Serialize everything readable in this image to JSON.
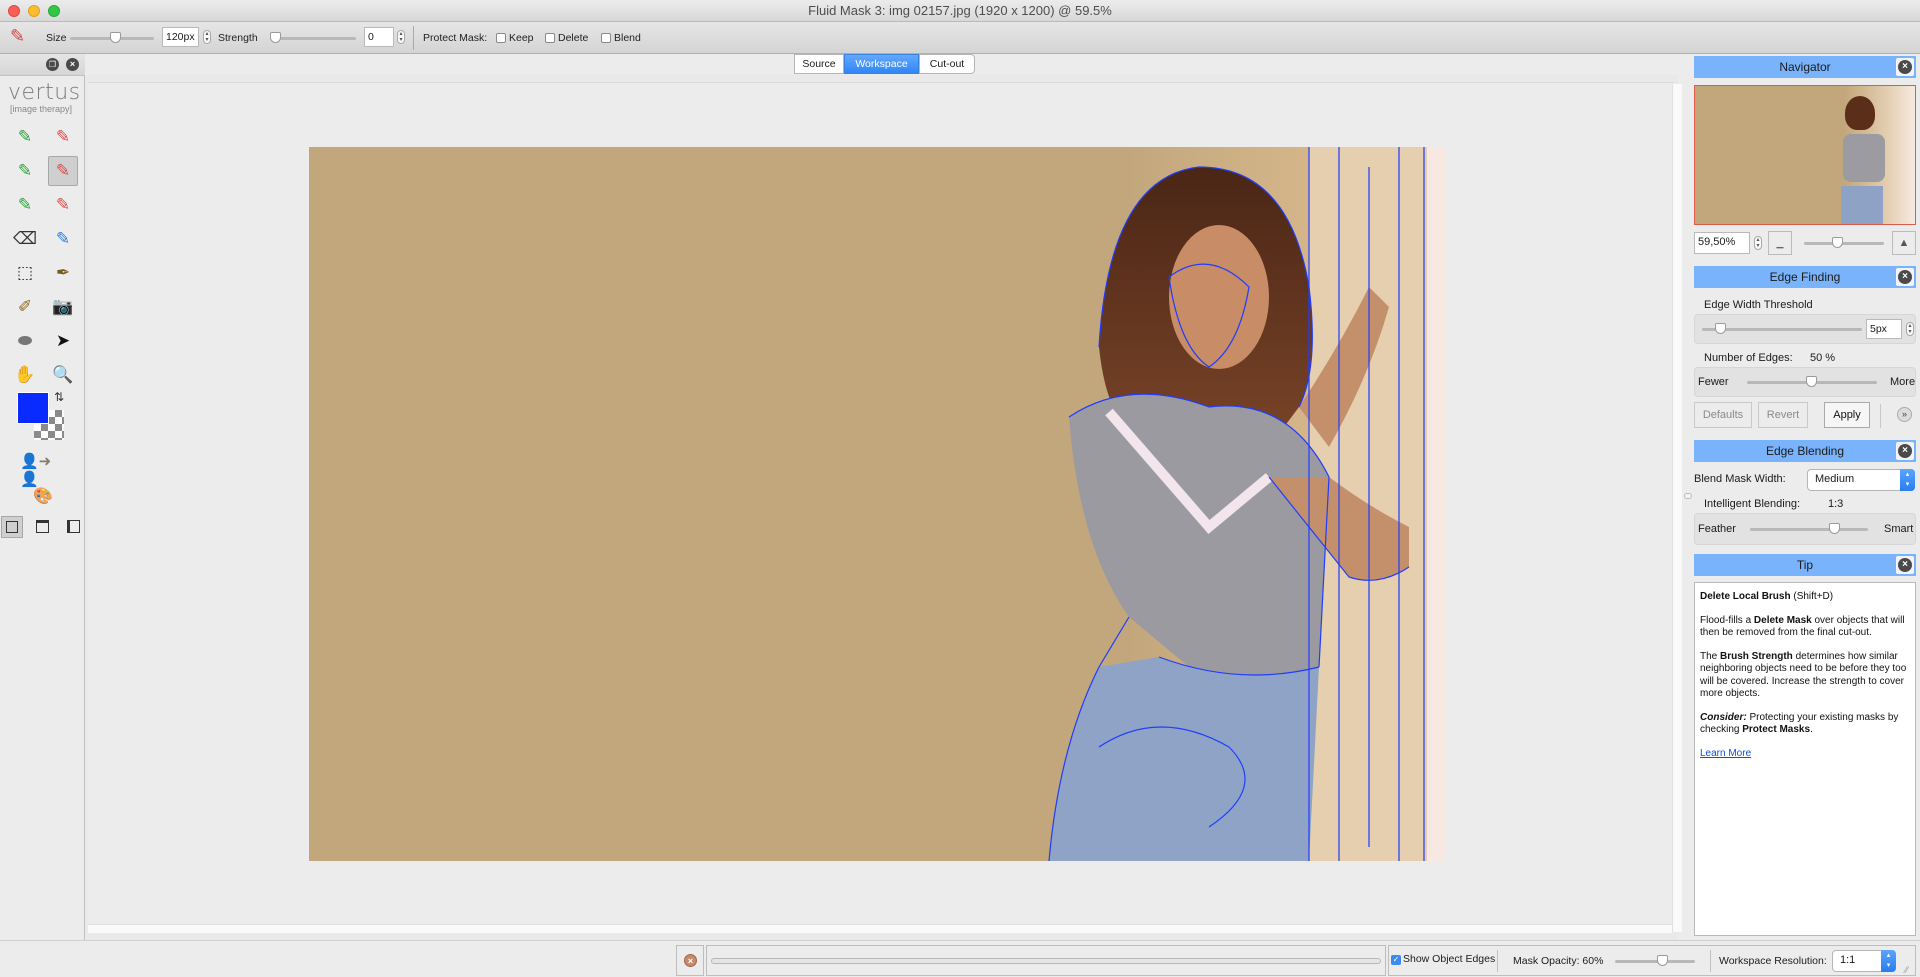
{
  "window": {
    "title": "Fluid Mask 3: img 02157.jpg (1920 x 1200) @ 59.5%",
    "traffic_lights": {
      "close": "#fc5f57",
      "minimize": "#fdbc2e",
      "zoom": "#33c748"
    }
  },
  "toolbar": {
    "brush_icon": "brush-icon",
    "size_label": "Size",
    "size_value": "120px",
    "size_slider_fraction": 0.55,
    "strength_label": "Strength",
    "strength_value": "0",
    "strength_slider_fraction": 0.0,
    "protect_mask_label": "Protect Mask:",
    "protect_options": [
      {
        "label": "Keep",
        "checked": false
      },
      {
        "label": "Delete",
        "checked": false
      },
      {
        "label": "Blend",
        "checked": false
      }
    ]
  },
  "left_panel": {
    "logo": "vertus",
    "logo_sub": "[image therapy]",
    "tools": [
      {
        "name": "keep-brush",
        "glyph": "✎",
        "color": "#2aa33a",
        "selected": false
      },
      {
        "name": "delete-brush",
        "glyph": "✎",
        "color": "#e04848",
        "selected": false
      },
      {
        "name": "keep-local-brush",
        "glyph": "✎",
        "color": "#2aa33a",
        "selected": false
      },
      {
        "name": "delete-local-brush",
        "glyph": "✎",
        "color": "#e04848",
        "selected": true
      },
      {
        "name": "keep-fill-brush",
        "glyph": "✎",
        "color": "#2aa33a",
        "selected": false
      },
      {
        "name": "delete-fill-brush",
        "glyph": "✎",
        "color": "#e04848",
        "selected": false
      },
      {
        "name": "eraser",
        "glyph": "⌫",
        "color": "#333333",
        "selected": false
      },
      {
        "name": "blend-brush",
        "glyph": "✎",
        "color": "#2d7ae0",
        "selected": false
      },
      {
        "name": "rect-select",
        "glyph": "⬚",
        "color": "#222222",
        "selected": false
      },
      {
        "name": "pen-mask",
        "glyph": "✒",
        "color": "#7a5a20",
        "selected": false
      },
      {
        "name": "color-picker",
        "glyph": "✐",
        "color": "#8a6a20",
        "selected": false
      },
      {
        "name": "snapshot",
        "glyph": "📷",
        "color": "#999999",
        "selected": false
      },
      {
        "name": "patch",
        "glyph": "⬬",
        "color": "#777777",
        "selected": false
      },
      {
        "name": "pointer",
        "glyph": "➤",
        "color": "#111111",
        "selected": false
      },
      {
        "name": "hand",
        "glyph": "✋",
        "color": "#444444",
        "selected": false
      },
      {
        "name": "zoom",
        "glyph": "🔍",
        "color": "#3a8ad0",
        "selected": false
      }
    ],
    "foreground_color": "#0a2bff",
    "view_modes": [
      "single-view",
      "split-horizontal",
      "split-vertical"
    ]
  },
  "view_tabs": [
    {
      "label": "Source",
      "active": false
    },
    {
      "label": "Workspace",
      "active": true
    },
    {
      "label": "Cut-out",
      "active": false
    }
  ],
  "canvas": {
    "background_color": "#c3a77c",
    "edge_color": "#1f3cff"
  },
  "navigator": {
    "title": "Navigator",
    "zoom_value": "59,50%",
    "zoom_slider_fraction": 0.42
  },
  "edge_finding": {
    "title": "Edge Finding",
    "width_threshold_label": "Edge Width Threshold",
    "width_threshold_value": "5px",
    "width_slider_fraction": 0.12,
    "num_edges_label": "Number of Edges:",
    "num_edges_value": "50 %",
    "num_edges_fraction": 0.5,
    "fewer_label": "Fewer",
    "more_label": "More",
    "defaults_label": "Defaults",
    "revert_label": "Revert",
    "apply_label": "Apply"
  },
  "edge_blending": {
    "title": "Edge Blending",
    "blend_width_label": "Blend Mask Width:",
    "blend_width_value": "Medium",
    "intelligent_label": "Intelligent Blending:",
    "intelligent_value": "1:3",
    "intelligent_fraction": 0.72,
    "feather_label": "Feather",
    "smart_label": "Smart"
  },
  "tip": {
    "title": "Tip",
    "heading_bold": "Delete Local Brush",
    "heading_rest": " (Shift+D)",
    "p1_a": "Flood-fills a ",
    "p1_b": "Delete Mask",
    "p1_c": " over objects that will then be removed from the final cut-out.",
    "p2_a": "The ",
    "p2_b": "Brush Strength",
    "p2_c": " determines how similar neighboring objects need to be before they too will be covered. Increase the strength to cover more objects.",
    "p3_a": "Consider:",
    "p3_b": " Protecting your existing masks by checking ",
    "p3_c": "Protect Masks",
    "p3_d": ".",
    "link": "Learn More"
  },
  "statusbar": {
    "progress_fraction": 0,
    "show_edges_label": "Show Object Edges",
    "show_edges_checked": true,
    "mask_opacity_label": "Mask Opacity: 60%",
    "mask_opacity_fraction": 0.6,
    "resolution_label": "Workspace Resolution:",
    "resolution_value": "1:1"
  }
}
